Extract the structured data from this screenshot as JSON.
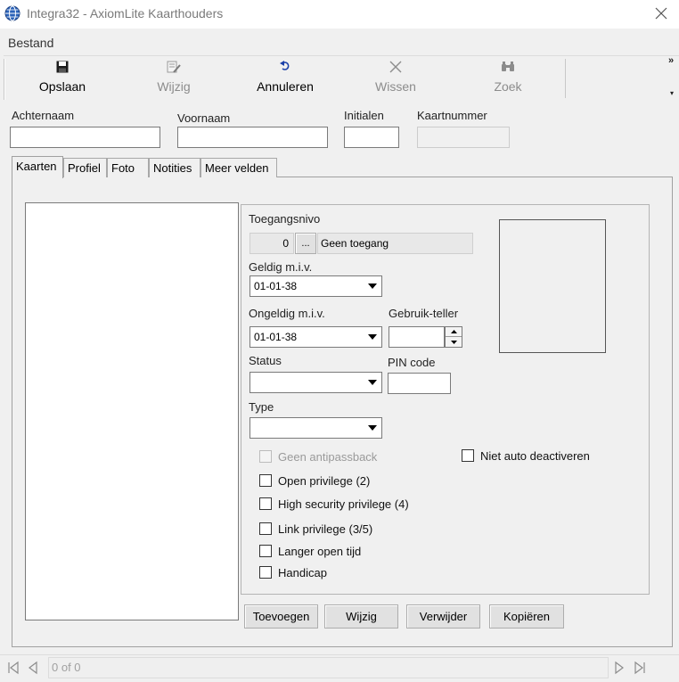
{
  "window": {
    "title": "Integra32 - AxiomLite Kaarthouders",
    "app_icon": "globe-icon",
    "close_icon": "close-icon"
  },
  "menu": {
    "bestand": "Bestand"
  },
  "toolbar": {
    "save": {
      "label": "Opslaan",
      "icon": "floppy-disk-icon",
      "enabled": true
    },
    "edit": {
      "label": "Wijzig",
      "icon": "edit-pencil-icon",
      "enabled": false
    },
    "cancel": {
      "label": "Annuleren",
      "icon": "undo-icon",
      "enabled": true
    },
    "delete": {
      "label": "Wissen",
      "icon": "x-icon",
      "enabled": false
    },
    "search": {
      "label": "Zoek",
      "icon": "binoculars-icon",
      "enabled": false
    },
    "more": "»"
  },
  "header_fields": {
    "achternaam": {
      "label": "Achternaam",
      "value": ""
    },
    "voornaam": {
      "label": "Voornaam",
      "value": ""
    },
    "initialen": {
      "label": "Initialen",
      "value": ""
    },
    "kaartnummer": {
      "label": "Kaartnummer",
      "value": ""
    }
  },
  "tabs": [
    {
      "label": "Kaarten",
      "active": true
    },
    {
      "label": "Profiel",
      "active": false
    },
    {
      "label": "Foto",
      "active": false
    },
    {
      "label": "Notities",
      "active": false
    },
    {
      "label": "Meer velden",
      "active": false
    }
  ],
  "details": {
    "toegangsnivo": {
      "label": "Toegangsnivo",
      "number": "0",
      "browse": "...",
      "name": "Geen toegang"
    },
    "geldig": {
      "label": "Geldig m.i.v.",
      "value": "01-01-38"
    },
    "ongeldig": {
      "label": "Ongeldig m.i.v.",
      "value": "01-01-38"
    },
    "gebruik_teller": {
      "label": "Gebruik-teller",
      "value": ""
    },
    "status": {
      "label": "Status",
      "value": ""
    },
    "pin_code": {
      "label": "PIN code",
      "value": ""
    },
    "type": {
      "label": "Type",
      "value": ""
    },
    "checkboxes": {
      "geen_antipassback": {
        "label": "Geen antipassback",
        "checked": false,
        "enabled": false
      },
      "open_privilege": {
        "label": "Open privilege (2)",
        "checked": false,
        "enabled": true
      },
      "high_security": {
        "label": "High security privilege (4)",
        "checked": false,
        "enabled": true
      },
      "link_privilege": {
        "label": "Link privilege (3/5)",
        "checked": false,
        "enabled": true
      },
      "langer_open": {
        "label": "Langer open tijd",
        "checked": false,
        "enabled": true
      },
      "handicap": {
        "label": "Handicap",
        "checked": false,
        "enabled": true
      },
      "niet_auto": {
        "label": "Niet auto deactiveren",
        "checked": false,
        "enabled": true
      }
    }
  },
  "buttons": {
    "toevoegen": "Toevoegen",
    "wijzig": "Wijzig",
    "verwijder": "Verwijder",
    "kopieren": "Kopiëren"
  },
  "navigator": {
    "record_text": "0 of 0"
  }
}
